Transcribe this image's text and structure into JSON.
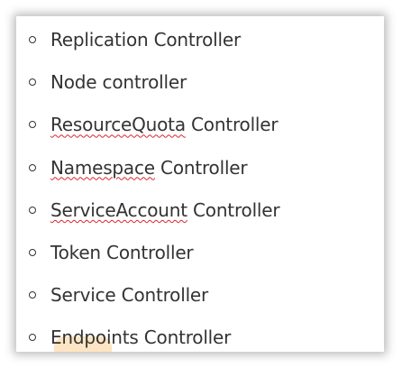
{
  "list": {
    "items": [
      {
        "underlined": "",
        "label": "Replication Controller"
      },
      {
        "underlined": "",
        "label": "Node controller"
      },
      {
        "underlined": "ResourceQuota",
        "label": " Controller"
      },
      {
        "underlined": "Namespace",
        "label": " Controller"
      },
      {
        "underlined": "ServiceAccount",
        "label": " Controller"
      },
      {
        "underlined": "",
        "label": "Token Controller"
      },
      {
        "underlined": "",
        "label": "Service Controller"
      },
      {
        "underlined": "",
        "label": "Endpoints Controller"
      }
    ]
  },
  "colors": {
    "text": "#333333",
    "spellcheck_underline": "#d9262c",
    "highlight": "#fde0b8"
  }
}
